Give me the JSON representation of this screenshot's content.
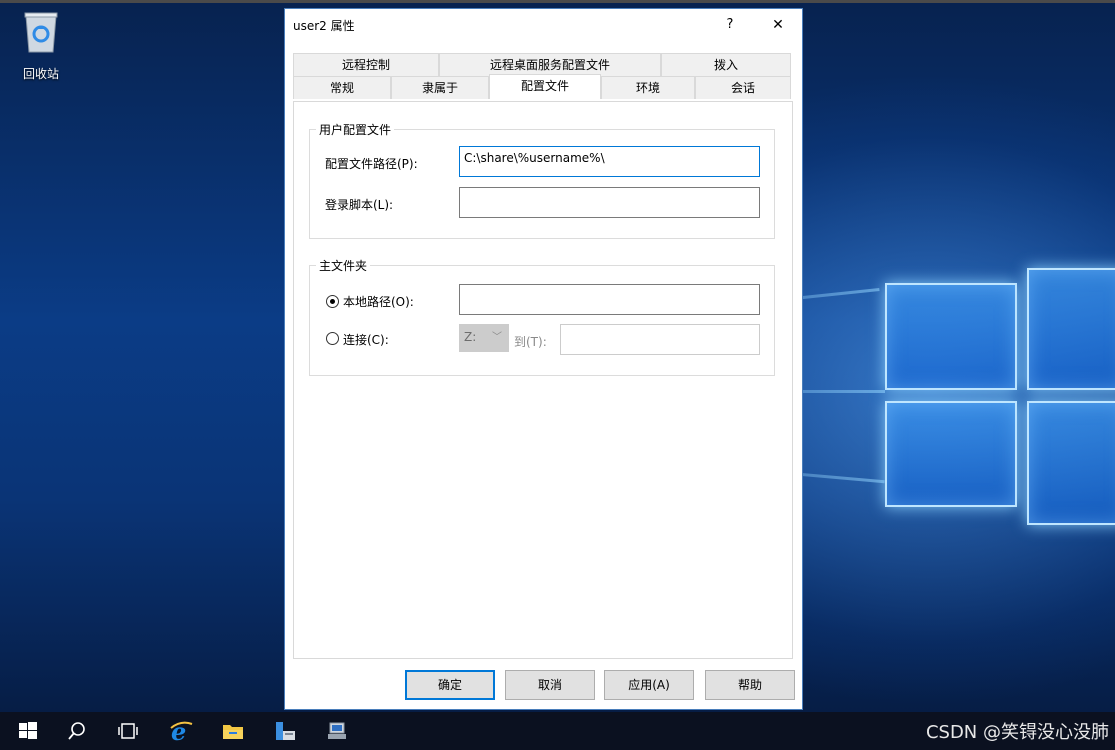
{
  "desktop": {
    "recycle_bin_label": "回收站"
  },
  "dialog": {
    "title": "user2 属性",
    "help_label": "?",
    "close_label": "✕",
    "tabs_row1": [
      "远程控制",
      "远程桌面服务配置文件",
      "拨入"
    ],
    "tabs_row2": [
      "常规",
      "隶属于",
      "配置文件",
      "环境",
      "会话"
    ],
    "active_tab": "配置文件",
    "user_profile": {
      "group_title": "用户配置文件",
      "profile_path_label": "配置文件路径(P):",
      "profile_path_value": "C:\\share\\%username%\\",
      "logon_script_label": "登录脚本(L):",
      "logon_script_value": ""
    },
    "home_folder": {
      "group_title": "主文件夹",
      "local_path_label": "本地路径(O):",
      "local_path_value": "",
      "local_path_selected": true,
      "connect_label": "连接(C):",
      "drive_value": "Z:",
      "to_label": "到(T):",
      "to_value": ""
    },
    "buttons": {
      "ok": "确定",
      "cancel": "取消",
      "apply": "应用(A)",
      "help": "帮助"
    }
  },
  "taskbar": {
    "icons": [
      "windows-start-icon",
      "search-icon",
      "task-view-icon",
      "internet-explorer-icon",
      "file-explorer-icon",
      "server-manager-icon",
      "network-icon"
    ]
  },
  "watermark": "CSDN @笑锝没心没肺",
  "colors": {
    "accent": "#0078d7",
    "taskbar": "#0b1120",
    "desktop": "#0b3c86"
  }
}
